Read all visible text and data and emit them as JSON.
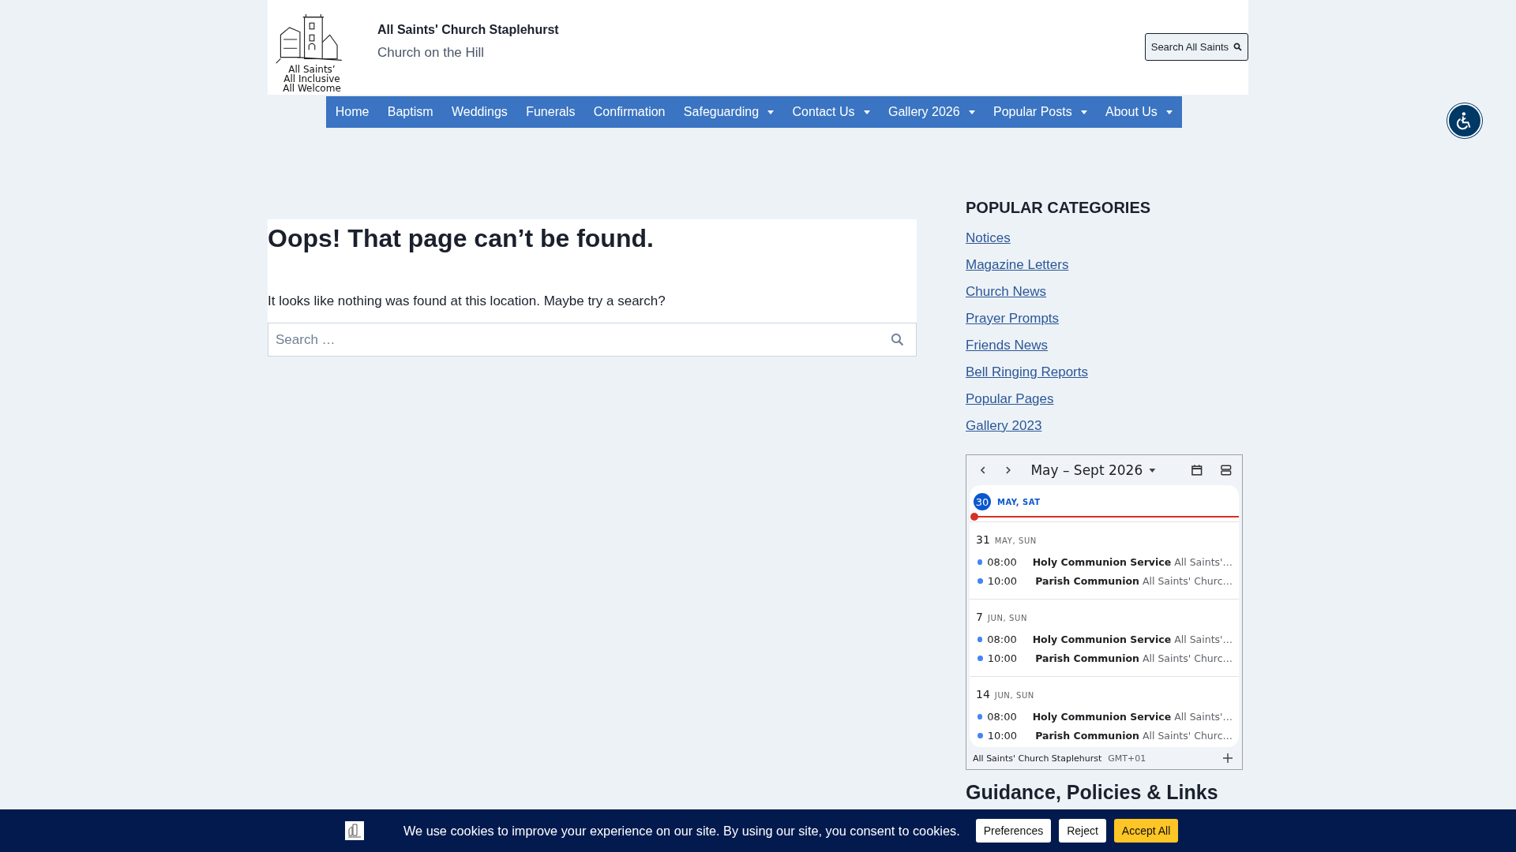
{
  "site": {
    "logo_lines": [
      "All Saints’",
      "All Inclusive",
      "All Welcome"
    ],
    "title": "All Saints' Church Staplehurst",
    "tagline": "Church on the Hill",
    "search_button": "Search All Saints"
  },
  "nav": [
    {
      "label": "Home",
      "has_dropdown": false
    },
    {
      "label": "Baptism",
      "has_dropdown": false
    },
    {
      "label": "Weddings",
      "has_dropdown": false
    },
    {
      "label": "Funerals",
      "has_dropdown": false
    },
    {
      "label": "Confirmation",
      "has_dropdown": false
    },
    {
      "label": "Safeguarding",
      "has_dropdown": true
    },
    {
      "label": "Contact Us",
      "has_dropdown": true
    },
    {
      "label": "Gallery 2026",
      "has_dropdown": true
    },
    {
      "label": "Popular Posts",
      "has_dropdown": true
    },
    {
      "label": "About Us",
      "has_dropdown": true
    }
  ],
  "main": {
    "title": "Oops! That page can’t be found.",
    "message": "It looks like nothing was found at this location. Maybe try a search?",
    "search": {
      "placeholder": "Search …"
    }
  },
  "sidebar": {
    "heading": "POPULAR CATEGORIES",
    "links": [
      "Notices",
      "Magazine Letters",
      "Church News",
      "Prayer Prompts",
      "Friends News",
      "Bell Ringing Reports",
      "Popular Pages",
      "Gallery 2023"
    ],
    "calendar": {
      "range": "May – Sept 2026",
      "today": {
        "day": "30",
        "label": "MAY, SAT"
      },
      "days": [
        {
          "day": "31",
          "label": "MAY, SUN",
          "events": [
            {
              "time": "08:00",
              "title": "Holy Communion Service",
              "location": "All Saints'…"
            },
            {
              "time": "10:00",
              "title": "Parish Communion",
              "location": "All Saints' Churc…"
            }
          ]
        },
        {
          "day": "7",
          "label": "JUN, SUN",
          "events": [
            {
              "time": "08:00",
              "title": "Holy Communion Service",
              "location": "All Saints'…"
            },
            {
              "time": "10:00",
              "title": "Parish Communion",
              "location": "All Saints' Churc…"
            }
          ]
        },
        {
          "day": "14",
          "label": "JUN, SUN",
          "events": [
            {
              "time": "08:00",
              "title": "Holy Communion Service",
              "location": "All Saints'…"
            },
            {
              "time": "10:00",
              "title": "Parish Communion",
              "location": "All Saints' Churc…"
            }
          ]
        }
      ],
      "calendar_name": "All Saints' Church Staplehurst",
      "timezone": "GMT+01"
    },
    "next_heading": "Guidance, Policies & Links"
  },
  "cookie_bar": {
    "message": "We use cookies to improve your experience on our site. By using our site, you consent to cookies.",
    "buttons": [
      {
        "label": "Preferences",
        "kind": "secondary"
      },
      {
        "label": "Reject",
        "kind": "secondary"
      },
      {
        "label": "Accept All",
        "kind": "primary"
      }
    ]
  }
}
